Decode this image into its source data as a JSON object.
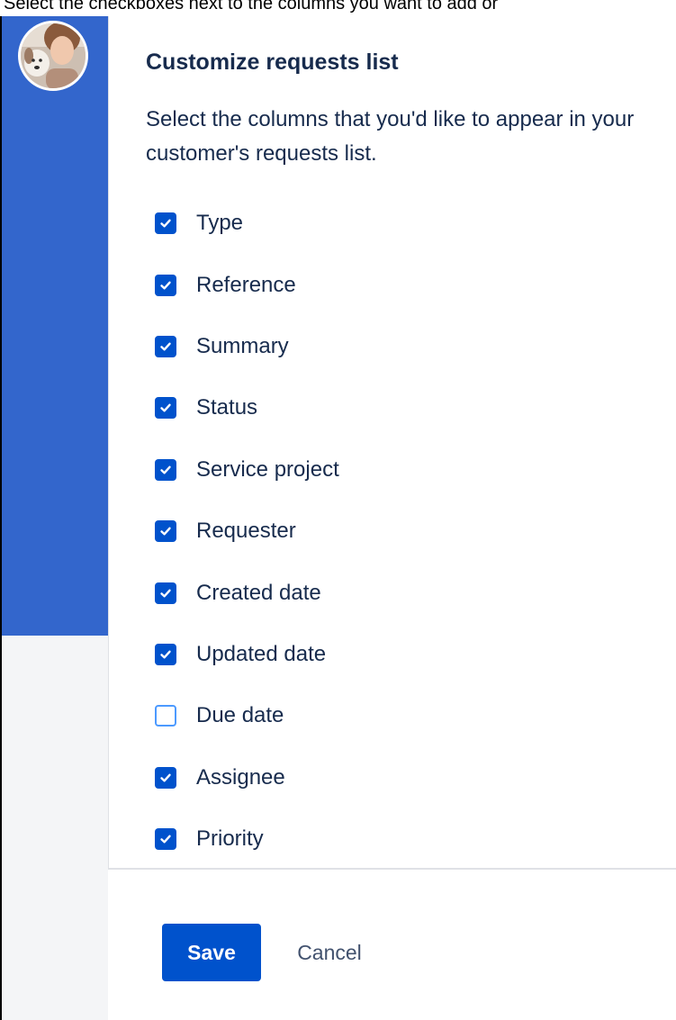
{
  "instruction_text": "Select the checkboxes next to the columns you want to add or",
  "colors": {
    "nav_blue": "#3366cc",
    "primary": "#0052cc",
    "text": "#172b4d",
    "unchecked_border": "#4c9aff"
  },
  "sidebar": {
    "avatar": {
      "icon": "user-avatar-photo"
    }
  },
  "panel": {
    "title": "Customize requests list",
    "description": "Select the columns that you'd like to appear in your customer's requests list.",
    "columns": [
      {
        "label": "Type",
        "checked": true
      },
      {
        "label": "Reference",
        "checked": true
      },
      {
        "label": "Summary",
        "checked": true
      },
      {
        "label": "Status",
        "checked": true
      },
      {
        "label": "Service project",
        "checked": true
      },
      {
        "label": "Requester",
        "checked": true
      },
      {
        "label": "Created date",
        "checked": true
      },
      {
        "label": "Updated date",
        "checked": true
      },
      {
        "label": "Due date",
        "checked": false
      },
      {
        "label": "Assignee",
        "checked": true
      },
      {
        "label": "Priority",
        "checked": true
      }
    ]
  },
  "footer": {
    "save_label": "Save",
    "cancel_label": "Cancel"
  }
}
